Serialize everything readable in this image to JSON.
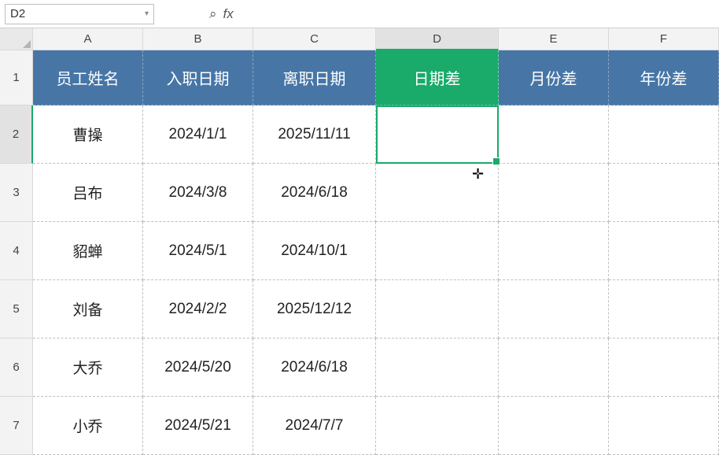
{
  "formula_bar": {
    "name_box_value": "D2",
    "fx_label": "fx",
    "formula_value": ""
  },
  "columns": [
    "A",
    "B",
    "C",
    "D",
    "E",
    "F"
  ],
  "active_column": "D",
  "active_row": 2,
  "headers": {
    "A": "员工姓名",
    "B": "入职日期",
    "C": "离职日期",
    "D": "日期差",
    "E": "月份差",
    "F": "年份差"
  },
  "highlight_header_col": "D",
  "rows": [
    {
      "num": 2,
      "A": "曹操",
      "B": "2024/1/1",
      "C": "2025/11/11",
      "D": "",
      "E": "",
      "F": ""
    },
    {
      "num": 3,
      "A": "吕布",
      "B": "2024/3/8",
      "C": "2024/6/18",
      "D": "",
      "E": "",
      "F": ""
    },
    {
      "num": 4,
      "A": "貂蝉",
      "B": "2024/5/1",
      "C": "2024/10/1",
      "D": "",
      "E": "",
      "F": ""
    },
    {
      "num": 5,
      "A": "刘备",
      "B": "2024/2/2",
      "C": "2025/12/12",
      "D": "",
      "E": "",
      "F": ""
    },
    {
      "num": 6,
      "A": "大乔",
      "B": "2024/5/20",
      "C": "2024/6/18",
      "D": "",
      "E": "",
      "F": ""
    },
    {
      "num": 7,
      "A": "小乔",
      "B": "2024/5/21",
      "C": "2024/7/7",
      "D": "",
      "E": "",
      "F": ""
    }
  ],
  "selection": {
    "cell": "D2"
  },
  "icons": {
    "zoom": "⌕",
    "cursor": "✛",
    "dropdown": "▾"
  },
  "colors": {
    "header_blue": "#4776a6",
    "header_green": "#1aaa6a"
  }
}
